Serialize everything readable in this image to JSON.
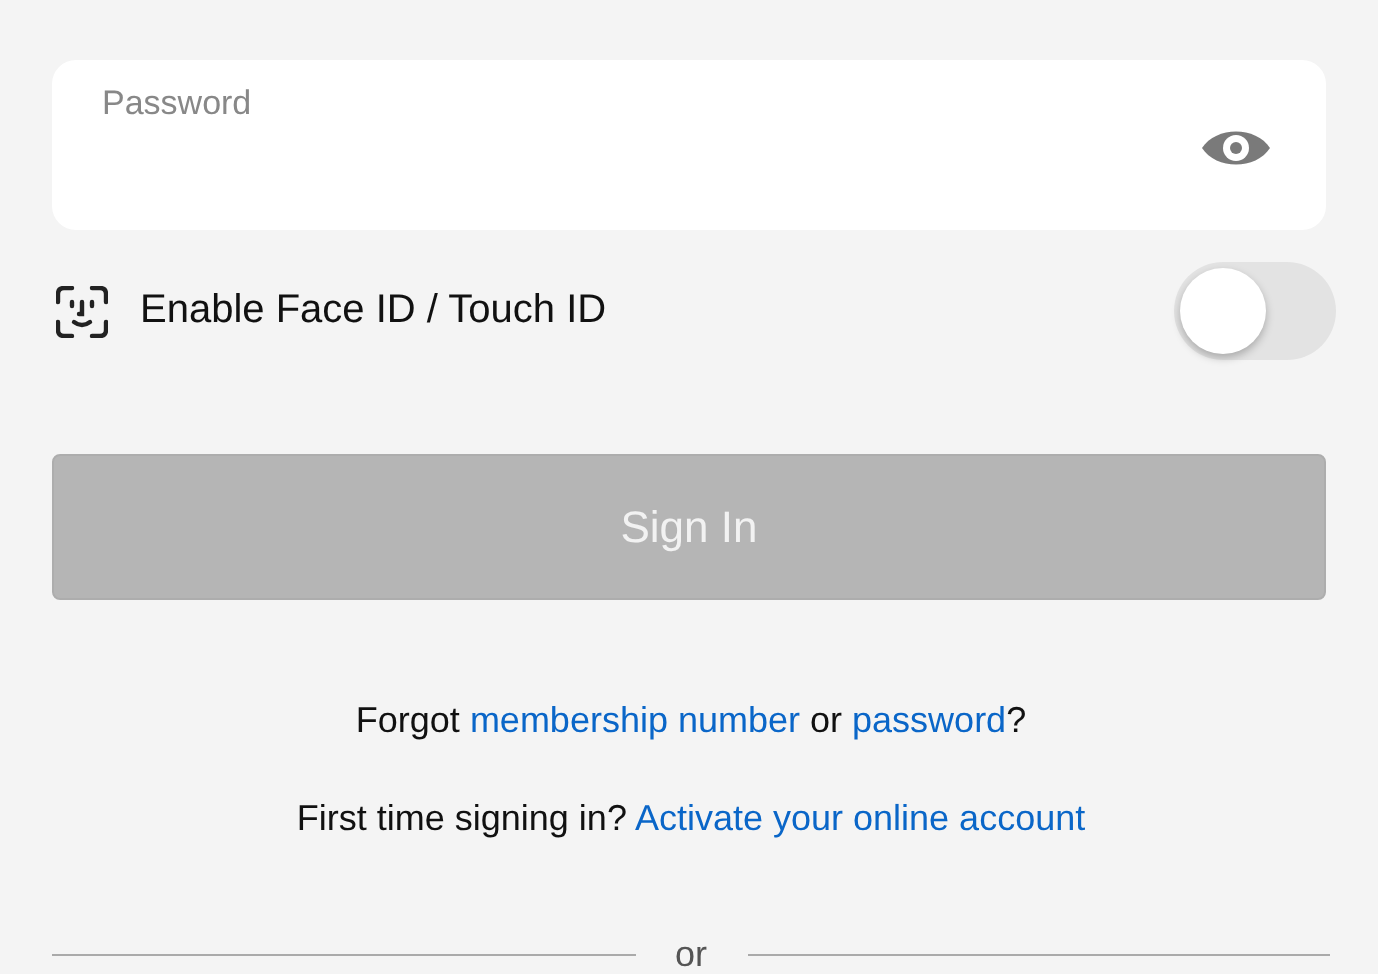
{
  "password_field": {
    "placeholder": "Password"
  },
  "biometric": {
    "label": "Enable Face ID / Touch ID",
    "on": false
  },
  "sign_in_button": {
    "label": "Sign In",
    "disabled": true
  },
  "forgot_line": [
    {
      "kind": "text",
      "text": "Forgot "
    },
    {
      "kind": "link",
      "text": "membership number"
    },
    {
      "kind": "text",
      "text": " or "
    },
    {
      "kind": "link",
      "text": "password"
    },
    {
      "kind": "text",
      "text": "?"
    }
  ],
  "activate_line": [
    {
      "kind": "text",
      "text": "First time signing in? "
    },
    {
      "kind": "link",
      "text": "Activate your online account"
    }
  ],
  "divider": {
    "label": "or"
  }
}
